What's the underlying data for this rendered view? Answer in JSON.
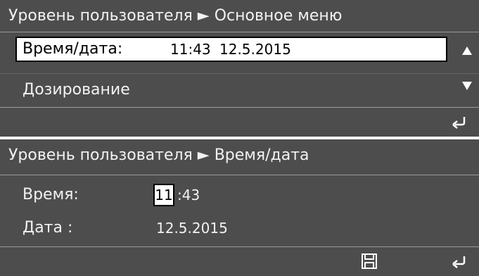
{
  "menu_screen": {
    "breadcrumb": "Уровень пользователя ► Основное меню",
    "selected_item": {
      "label": "Время/дата:",
      "time": "11:43",
      "date": "12.5.2015"
    },
    "next_item": "Дозирование",
    "icons": {
      "up": "arrow-up-icon",
      "down": "arrow-down-icon",
      "back": "return-arrow-icon"
    }
  },
  "time_screen": {
    "breadcrumb": "Уровень пользователя ► Время/дата",
    "time_label": "Время:",
    "hour": "11",
    "minutes": ":43",
    "date_label": "Дата :",
    "date": "12.5.2015",
    "icons": {
      "save": "floppy-disk-icon",
      "back": "return-arrow-icon"
    }
  },
  "colors": {
    "panel_background": "#4d4d4d",
    "highlight_background": "#ffffff",
    "text": "#f2f2f2"
  }
}
